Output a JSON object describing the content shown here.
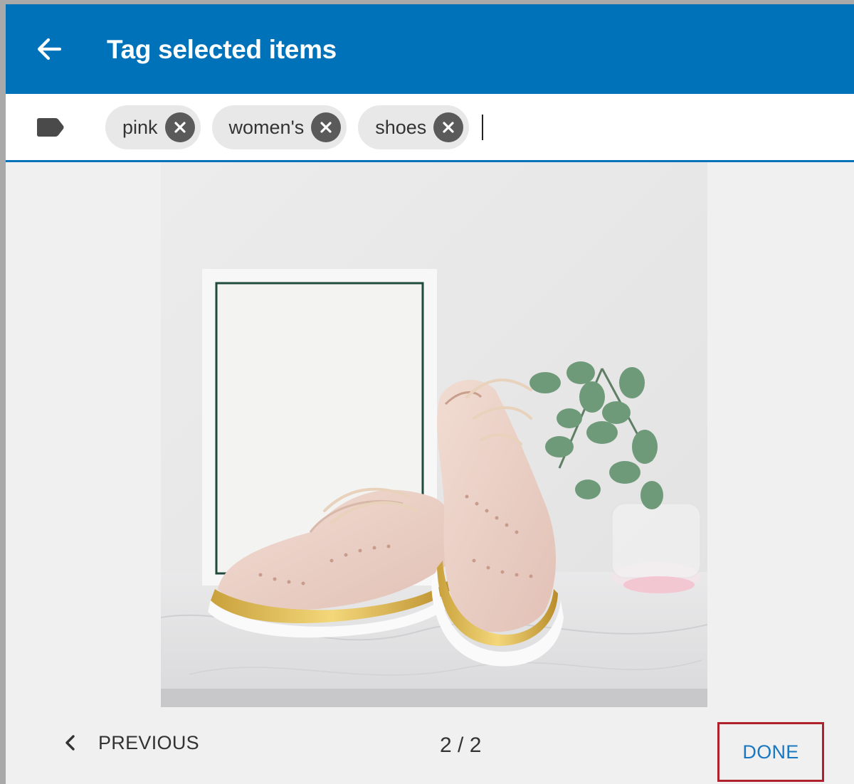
{
  "header": {
    "title": "Tag selected items",
    "back_icon": "arrow-left-icon",
    "background": "#0072b9"
  },
  "tag_bar": {
    "icon": "tag-icon",
    "tags": [
      {
        "label": "pink"
      },
      {
        "label": "women's"
      },
      {
        "label": "shoes"
      }
    ],
    "remove_icon": "close-circle-icon",
    "accent": "#0072b9"
  },
  "photo": {
    "subject": "pink brogue shoes"
  },
  "footer": {
    "previous_label": "PREVIOUS",
    "previous_icon": "chevron-left-icon",
    "pager": "2 / 2",
    "done_label": "DONE",
    "done_color": "#1a78c2",
    "highlight_color": "#b0212e"
  }
}
